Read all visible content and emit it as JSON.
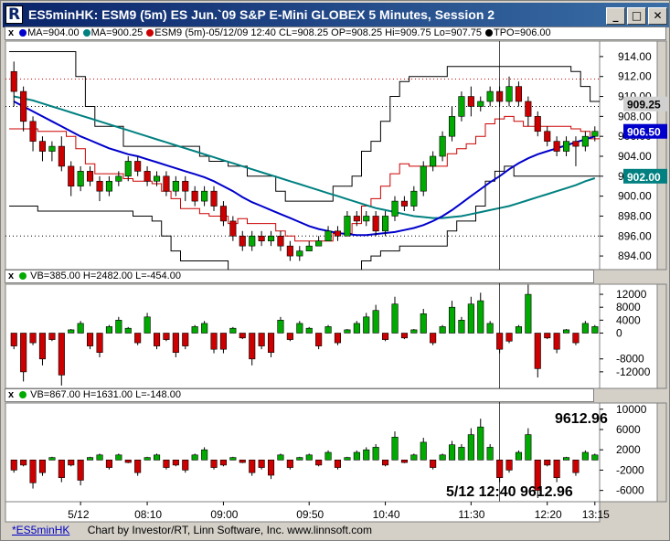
{
  "window": {
    "title": "ES5minHK: ESM9 (5m) ES Jun.`09 S&P E-Mini GLOBEX 5 Minutes, Session 2",
    "controls": {
      "minimize": "_",
      "maximize": "□",
      "close": "✕"
    }
  },
  "price_panel": {
    "close_glyph": "x",
    "legend": [
      {
        "text": "MA=904.00",
        "color": "#0000cc"
      },
      {
        "text": "MA=900.25",
        "color": "#008080"
      },
      {
        "text": "ESM9 (5m)-05/12/09 12:40 CL=908.25 OP=908.25 Hi=909.75 Lo=907.75",
        "color": "#cc0000"
      },
      {
        "text": "TPO=906.00",
        "color": "#000000"
      }
    ],
    "badges": [
      {
        "text": "909.25",
        "bg": "#d0d0d0",
        "fg": "#000000",
        "value": 909.25
      },
      {
        "text": "906.50",
        "bg": "#0000cc",
        "fg": "#ffffff",
        "value": 906.5
      },
      {
        "text": "902.00",
        "bg": "#008080",
        "fg": "#ffffff",
        "value": 902.0
      }
    ]
  },
  "vb1_panel": {
    "close_glyph": "x",
    "legend": "VB=385.00 H=2482.00 L=-454.00"
  },
  "vb2_panel": {
    "close_glyph": "x",
    "legend": "VB=867.00 H=1631.00 L=-148.00",
    "readout_value": "9612.96",
    "readout_cursor": "5/12 12:40 9612.96"
  },
  "time_axis": [
    "5/12",
    "08:10",
    "09:00",
    "09:50",
    "10:40",
    "11:30",
    "12:20",
    "13:15"
  ],
  "status_bar": {
    "tab": "*ES5minHK",
    "credit": "Chart by Investor/RT, Linn Software, Inc. www.linnsoft.com"
  },
  "colors": {
    "up": "#00aa00",
    "down": "#cc0000",
    "ma_fast": "#0000cc",
    "ma_slow": "#008080",
    "background": "#ffffff"
  },
  "chart_data": [
    {
      "type": "candlestick",
      "title": "ESM9 (5m)",
      "ylim": [
        893,
        915
      ],
      "y_ticks": [
        894,
        896,
        898,
        900,
        902,
        904,
        906,
        908,
        910,
        912,
        914
      ],
      "x_labels": [
        "5/12",
        "08:10",
        "09:00",
        "09:50",
        "10:40",
        "11:30",
        "12:20",
        "13:15"
      ],
      "candles": [
        [
          912.5,
          910.5,
          913.5,
          909.0
        ],
        [
          910.5,
          907.5,
          911.0,
          906.5
        ],
        [
          907.5,
          905.5,
          908.0,
          904.5
        ],
        [
          905.5,
          904.5,
          906.0,
          903.5
        ],
        [
          904.5,
          905.0,
          905.5,
          903.5
        ],
        [
          905.0,
          903.0,
          906.0,
          902.5
        ],
        [
          903.0,
          901.0,
          903.5,
          900.0
        ],
        [
          901.0,
          902.5,
          903.0,
          900.5
        ],
        [
          902.5,
          901.5,
          903.0,
          901.0
        ],
        [
          901.5,
          900.5,
          902.0,
          899.5
        ],
        [
          900.5,
          901.5,
          902.0,
          900.0
        ],
        [
          901.5,
          902.0,
          902.5,
          901.0
        ],
        [
          902.0,
          903.5,
          904.0,
          901.5
        ],
        [
          903.5,
          902.5,
          904.0,
          902.0
        ],
        [
          902.5,
          901.5,
          903.0,
          901.0
        ],
        [
          901.5,
          902.0,
          902.5,
          901.0
        ],
        [
          902.0,
          900.5,
          902.5,
          900.0
        ],
        [
          900.5,
          901.5,
          902.0,
          900.0
        ],
        [
          901.5,
          900.5,
          902.0,
          899.5
        ],
        [
          900.5,
          899.5,
          901.0,
          899.0
        ],
        [
          899.5,
          900.5,
          901.0,
          899.0
        ],
        [
          900.5,
          899.0,
          901.0,
          898.5
        ],
        [
          899.0,
          897.5,
          899.5,
          897.0
        ],
        [
          897.5,
          896.0,
          898.0,
          895.5
        ],
        [
          896.0,
          895.0,
          896.5,
          894.5
        ],
        [
          895.0,
          896.0,
          896.5,
          894.5
        ],
        [
          896.0,
          895.5,
          896.5,
          895.0
        ],
        [
          895.5,
          896.0,
          896.5,
          895.0
        ],
        [
          896.0,
          895.0,
          896.5,
          894.5
        ],
        [
          895.0,
          894.0,
          895.5,
          893.5
        ],
        [
          894.0,
          894.5,
          895.0,
          893.5
        ],
        [
          894.5,
          895.0,
          895.5,
          894.5
        ],
        [
          895.0,
          895.5,
          896.0,
          895.0
        ],
        [
          895.5,
          896.5,
          897.0,
          895.5
        ],
        [
          896.5,
          896.0,
          897.0,
          895.5
        ],
        [
          896.0,
          898.0,
          898.5,
          896.0
        ],
        [
          898.0,
          897.5,
          898.5,
          897.0
        ],
        [
          897.5,
          898.0,
          898.5,
          897.0
        ],
        [
          898.0,
          896.5,
          898.5,
          896.0
        ],
        [
          896.5,
          898.0,
          898.5,
          896.0
        ],
        [
          898.0,
          899.5,
          900.0,
          897.5
        ],
        [
          899.5,
          899.0,
          900.0,
          898.5
        ],
        [
          899.0,
          900.5,
          901.0,
          898.5
        ],
        [
          900.5,
          903.0,
          903.5,
          900.0
        ],
        [
          903.0,
          904.0,
          904.5,
          902.5
        ],
        [
          904.0,
          906.0,
          906.5,
          903.5
        ],
        [
          906.0,
          908.0,
          909.0,
          905.5
        ],
        [
          908.0,
          910.0,
          910.5,
          907.5
        ],
        [
          910.0,
          909.0,
          911.0,
          908.0
        ],
        [
          909.0,
          909.5,
          910.0,
          908.5
        ],
        [
          909.5,
          910.5,
          911.0,
          909.0
        ],
        [
          910.5,
          909.5,
          911.0,
          909.0
        ],
        [
          909.5,
          911.0,
          912.0,
          909.0
        ],
        [
          911.0,
          909.5,
          911.5,
          909.0
        ],
        [
          909.5,
          908.0,
          910.0,
          907.0
        ],
        [
          908.0,
          906.5,
          908.5,
          906.0
        ],
        [
          906.5,
          905.5,
          907.0,
          905.0
        ],
        [
          905.5,
          904.5,
          906.0,
          904.0
        ],
        [
          904.5,
          905.5,
          906.0,
          904.0
        ],
        [
          905.5,
          905.0,
          906.0,
          903.0
        ],
        [
          905.0,
          906.0,
          906.5,
          904.5
        ],
        [
          906.0,
          906.5,
          907.0,
          905.5
        ]
      ],
      "ma_fast": [
        909.5,
        909.0,
        908.5,
        908.0,
        907.5,
        907.0,
        906.5,
        906.0,
        905.6,
        905.2,
        904.8,
        904.5,
        904.2,
        904.0,
        903.7,
        903.4,
        903.1,
        902.8,
        902.5,
        902.2,
        901.9,
        901.5,
        901.0,
        900.5,
        899.9,
        899.4,
        899.0,
        898.6,
        898.2,
        897.8,
        897.4,
        897.0,
        896.7,
        896.5,
        896.3,
        896.2,
        896.1,
        896.1,
        896.2,
        896.3,
        896.4,
        896.6,
        896.8,
        897.1,
        897.5,
        898.0,
        898.6,
        899.3,
        900.0,
        900.7,
        901.4,
        902.0,
        902.7,
        903.3,
        903.8,
        904.2,
        904.5,
        904.8,
        905.1,
        905.4,
        905.7,
        906.0
      ],
      "ma_slow": [
        910.0,
        909.8,
        909.6,
        909.3,
        909.0,
        908.7,
        908.4,
        908.1,
        907.8,
        907.5,
        907.2,
        906.9,
        906.6,
        906.3,
        906.0,
        905.7,
        905.4,
        905.1,
        904.8,
        904.5,
        904.2,
        903.9,
        903.6,
        903.3,
        903.0,
        902.7,
        902.4,
        902.1,
        901.8,
        901.5,
        901.2,
        900.9,
        900.6,
        900.3,
        900.0,
        899.7,
        899.4,
        899.1,
        898.8,
        898.6,
        898.4,
        898.2,
        898.0,
        897.9,
        897.8,
        897.8,
        897.9,
        898.0,
        898.2,
        898.4,
        898.6,
        898.8,
        899.0,
        899.3,
        899.6,
        899.9,
        900.2,
        900.5,
        900.8,
        901.1,
        901.5,
        901.8
      ]
    },
    {
      "type": "bar",
      "title": "VB=385.00 H=2482.00 L=-454.00",
      "ylim": [
        -16000,
        14000
      ],
      "y_ticks": [
        12000,
        8000,
        4000,
        0,
        -8000,
        -12000
      ],
      "values": [
        -4000,
        -12000,
        -3000,
        -8000,
        -2000,
        -13000,
        1000,
        3000,
        -4000,
        -6000,
        2000,
        4000,
        1500,
        -3000,
        5000,
        -4000,
        -2000,
        -6000,
        -4000,
        2000,
        3000,
        -5000,
        -5000,
        1500,
        -1500,
        -8000,
        -4000,
        -6000,
        4000,
        -2000,
        3000,
        1500,
        -4000,
        2000,
        -3000,
        1000,
        3000,
        5000,
        7000,
        -2000,
        9000,
        -1500,
        1000,
        6000,
        -3000,
        2000,
        8000,
        4000,
        9000,
        10000,
        3000,
        -5000,
        -2500,
        2000,
        12000,
        -11000,
        -1500,
        -5000,
        1000,
        -3000,
        3000,
        2000
      ]
    },
    {
      "type": "bar",
      "title": "VB=867.00 H=1631.00 L=-148.00",
      "ylim": [
        -7500,
        10500
      ],
      "y_ticks": [
        10000,
        6000,
        2000,
        -2000,
        -6000
      ],
      "values": [
        -2000,
        -1000,
        -4500,
        -2500,
        500,
        -3500,
        -1000,
        -4000,
        500,
        1000,
        -1500,
        1000,
        -500,
        -2500,
        500,
        1000,
        -1500,
        -1000,
        -2000,
        1000,
        2000,
        -1500,
        -1000,
        500,
        -500,
        -2500,
        -1500,
        -3000,
        1000,
        -1500,
        500,
        1000,
        -1000,
        1500,
        -1500,
        500,
        1500,
        2000,
        2500,
        -1000,
        4500,
        -500,
        1000,
        3500,
        -1500,
        1000,
        3000,
        2500,
        5000,
        6500,
        2500,
        -3500,
        -2000,
        1500,
        5000,
        -6000,
        -1000,
        -3500,
        500,
        -2500,
        1500,
        1000
      ]
    }
  ]
}
